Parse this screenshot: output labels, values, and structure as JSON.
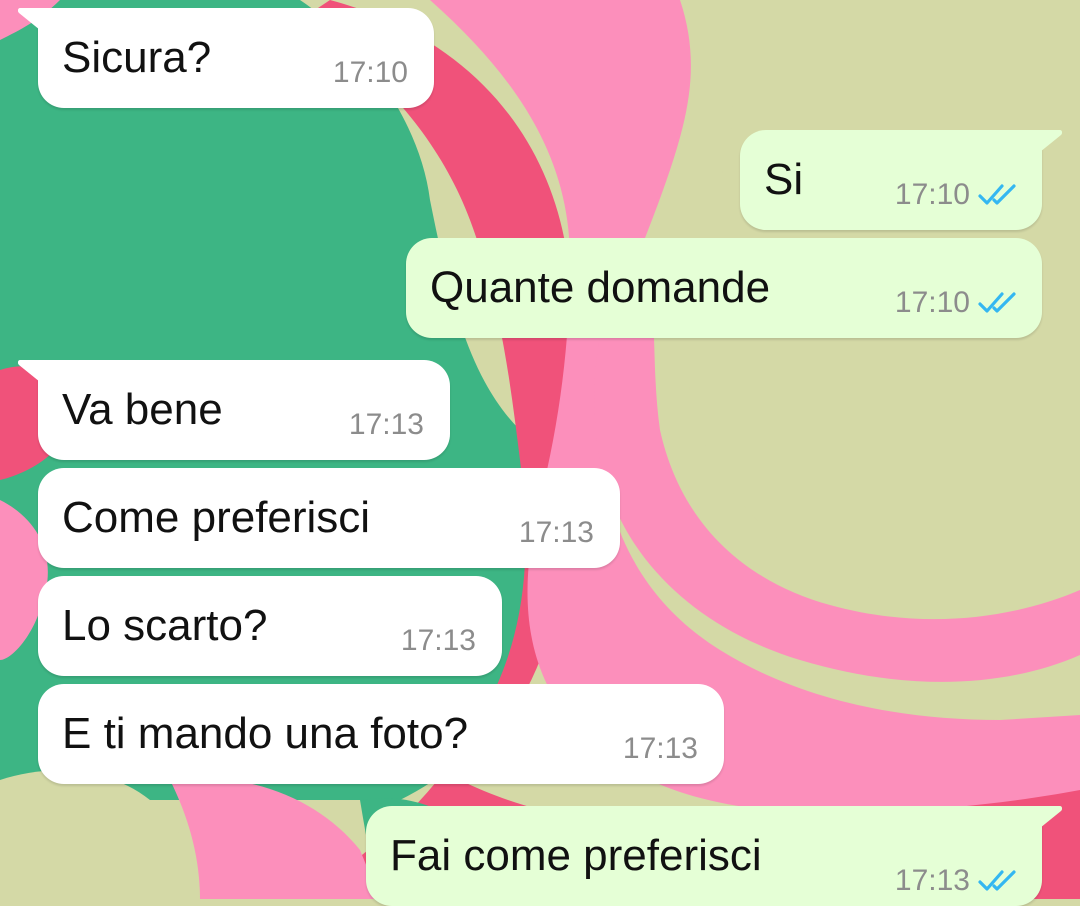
{
  "colors": {
    "incoming_bubble": "#ffffff",
    "outgoing_bubble": "#e5ffd6",
    "read_ticks": "#34b7f1",
    "timestamp": "#8c8c8c",
    "wallpaper_green": "#3db584",
    "wallpaper_pink": "#fc8fbb",
    "wallpaper_red": "#f0527a",
    "wallpaper_olive": "#d4d9a6"
  },
  "icons": {
    "read_receipt": "double-check-icon"
  },
  "messages": [
    {
      "direction": "incoming",
      "text": "Sicura?",
      "time": "17:10"
    },
    {
      "direction": "outgoing",
      "text": "Si",
      "time": "17:10",
      "status": "read"
    },
    {
      "direction": "outgoing",
      "text": "Quante domande",
      "time": "17:10",
      "status": "read"
    },
    {
      "direction": "incoming",
      "text": "Va bene",
      "time": "17:13"
    },
    {
      "direction": "incoming",
      "text": "Come preferisci",
      "time": "17:13"
    },
    {
      "direction": "incoming",
      "text": "Lo scarto?",
      "time": "17:13"
    },
    {
      "direction": "incoming",
      "text": "E ti mando una foto?",
      "time": "17:13"
    },
    {
      "direction": "outgoing",
      "text": "Fai come preferisci",
      "time": "17:13",
      "status": "read"
    }
  ]
}
